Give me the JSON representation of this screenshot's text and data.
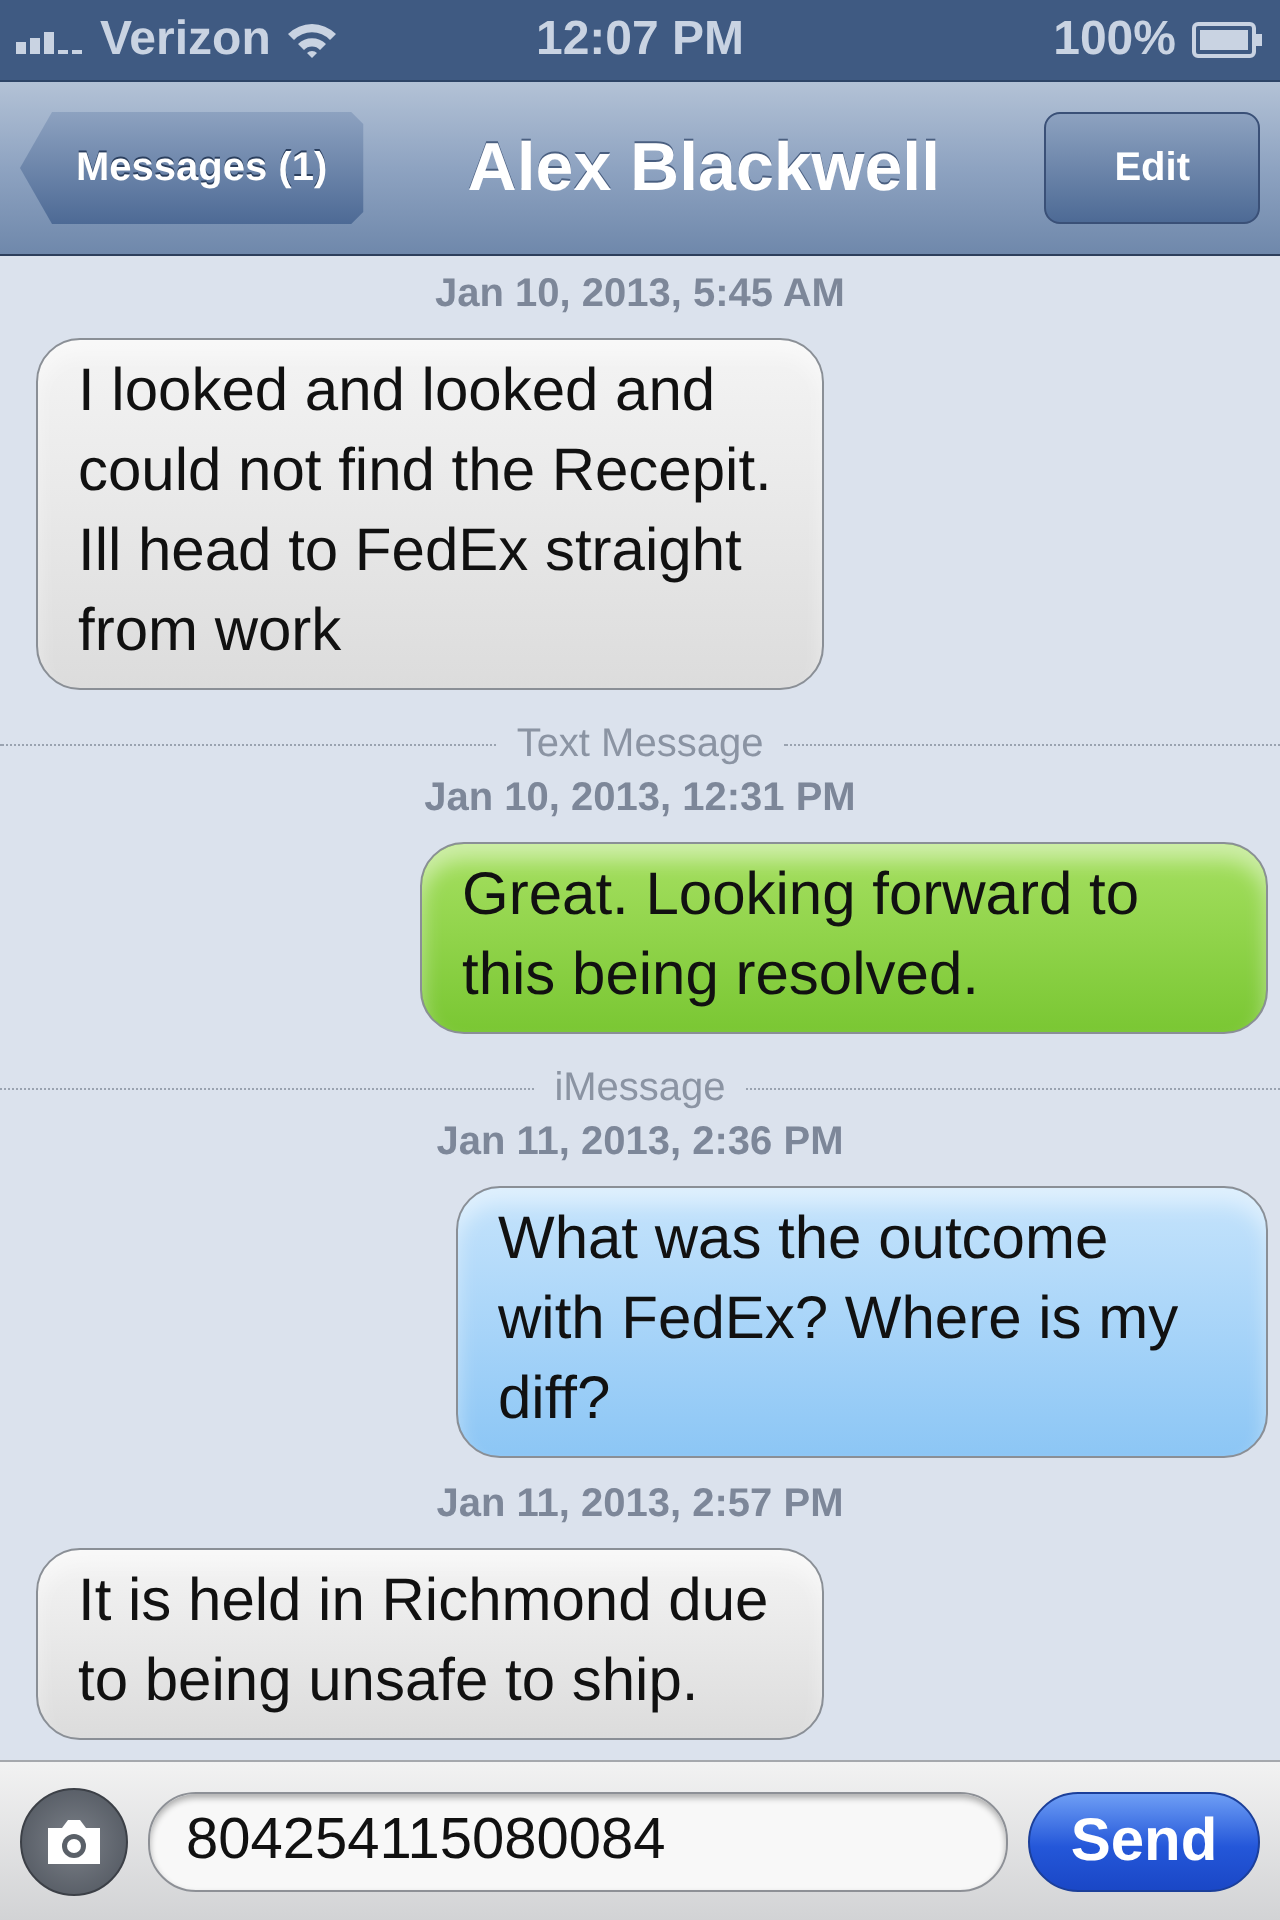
{
  "status_bar": {
    "carrier": "Verizon",
    "time": "12:07 PM",
    "battery": "100%"
  },
  "nav_bar": {
    "back_button": "Messages (1)",
    "title": "Alex Blackwell",
    "edit_button": "Edit"
  },
  "messages": [
    {
      "kind": "timestamp",
      "text": "Jan 10, 2013, 5:45 AM"
    },
    {
      "kind": "received",
      "text": "I looked and looked and could not find the Recepit. Ill head to FedEx straight from work"
    },
    {
      "kind": "divider",
      "text": "Text Message"
    },
    {
      "kind": "timestamp",
      "text": "Jan 10, 2013, 12:31 PM"
    },
    {
      "kind": "sent_sms",
      "text": "Great. Looking forward to this being resolved."
    },
    {
      "kind": "divider",
      "text": "iMessage"
    },
    {
      "kind": "timestamp",
      "text": "Jan 11, 2013, 2:36 PM"
    },
    {
      "kind": "sent_imessage",
      "text": "What was the outcome with FedEx? Where is my diff?"
    },
    {
      "kind": "timestamp",
      "text": "Jan 11, 2013, 2:57 PM"
    },
    {
      "kind": "received",
      "text": "It is held in Richmond due to being unsafe to ship."
    }
  ],
  "composer": {
    "value": "804254115080084",
    "send_button": "Send"
  }
}
